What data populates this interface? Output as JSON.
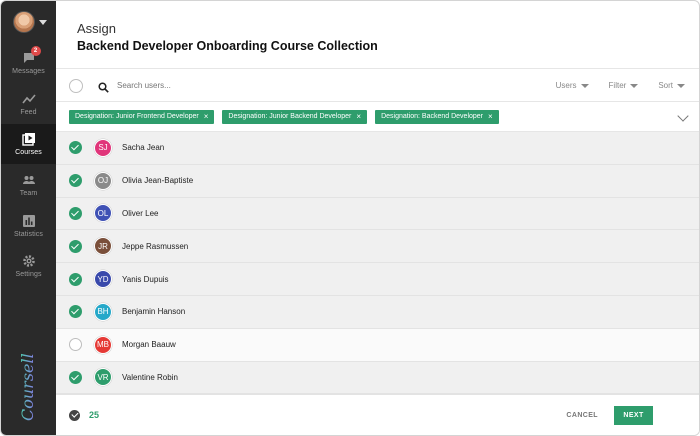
{
  "sidebar": {
    "items": [
      {
        "label": "Messages",
        "icon": "message-icon",
        "badge": "2",
        "active": false
      },
      {
        "label": "Feed",
        "icon": "feed-icon",
        "active": false
      },
      {
        "label": "Courses",
        "icon": "courses-icon",
        "active": true
      },
      {
        "label": "Team",
        "icon": "team-icon",
        "active": false
      },
      {
        "label": "Statistics",
        "icon": "statistics-icon",
        "active": false
      },
      {
        "label": "Settings",
        "icon": "settings-icon",
        "active": false
      }
    ],
    "brand": "Coursello"
  },
  "header": {
    "action": "Assign",
    "title": "Backend Developer Onboarding Course Collection"
  },
  "toolbar": {
    "search_placeholder": "Search users...",
    "dropdowns": [
      "Users",
      "Filter",
      "Sort"
    ]
  },
  "filters": [
    "Designation: Junior Frontend Developer",
    "Designation: Junior Backend Developer",
    "Designation: Backend Developer"
  ],
  "users": [
    {
      "initials": "SJ",
      "name": "Sacha Jean",
      "checked": true,
      "color": "#e0357a"
    },
    {
      "initials": "OJ",
      "name": "Olivia Jean-Baptiste",
      "checked": true,
      "color": "#8a8a8a"
    },
    {
      "initials": "OL",
      "name": "Oliver Lee",
      "checked": true,
      "color": "#3f51b5"
    },
    {
      "initials": "JR",
      "name": "Jeppe Rasmussen",
      "checked": true,
      "color": "#7a4f3a"
    },
    {
      "initials": "YD",
      "name": "Yanis Dupuis",
      "checked": true,
      "color": "#3949ab"
    },
    {
      "initials": "BH",
      "name": "Benjamin Hanson",
      "checked": true,
      "color": "#26a8c9"
    },
    {
      "initials": "MB",
      "name": "Morgan Baauw",
      "checked": false,
      "color": "#e53935"
    },
    {
      "initials": "VR",
      "name": "Valentine Robin",
      "checked": true,
      "color": "#2e9d6c"
    }
  ],
  "footer": {
    "selected_count": "25",
    "cancel_label": "CANCEL",
    "next_label": "NEXT"
  },
  "colors": {
    "accent": "#2e9d6c",
    "sidebar": "#2a2a2a"
  }
}
